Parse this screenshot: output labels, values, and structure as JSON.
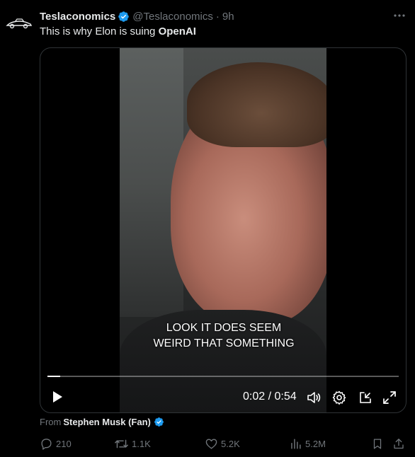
{
  "author": {
    "display_name": "Teslaconomics",
    "handle": "@Teslaconomics",
    "separator": "·",
    "time": "9h",
    "verified_color": "#1d9bf0"
  },
  "tweet": {
    "text_prefix": "This is why Elon is suing ",
    "text_bold": "OpenAI"
  },
  "video": {
    "caption_line1": "LOOK IT DOES SEEM",
    "caption_line2": "WEIRD THAT SOMETHING",
    "time_readout": "0:02 / 0:54",
    "progress_fraction": 0.037,
    "icons": [
      "play-icon",
      "volume-icon",
      "settings-icon",
      "pop-out-icon",
      "fullscreen-icon"
    ]
  },
  "from": {
    "label": "From",
    "name": "Stephen Musk (Fan)"
  },
  "actions": {
    "replies": "210",
    "reposts": "1.1K",
    "likes": "5.2K",
    "views": "5.2M"
  },
  "colors": {
    "background": "#000000",
    "text_primary": "#e7e9ea",
    "text_secondary": "#71767b",
    "verified": "#1d9bf0",
    "border": "#2f3336"
  }
}
